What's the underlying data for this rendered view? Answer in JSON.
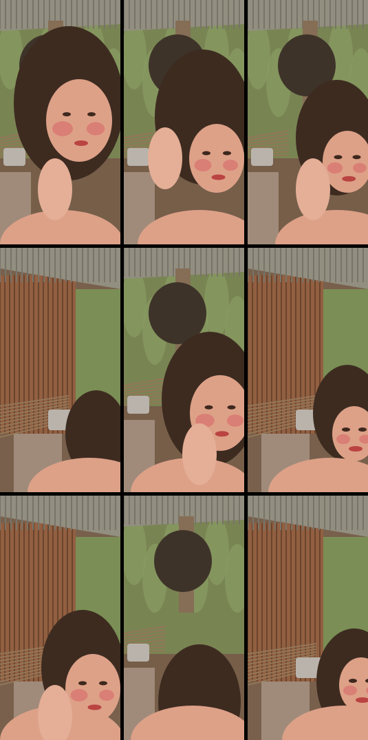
{
  "collage": {
    "layout": "3x3 photo grid",
    "divider_color": "#000000",
    "tiles": [
      {
        "subject": "woman-face-closeup",
        "scene": "outdoor-kitchen"
      },
      {
        "subject": "woman-hand-in-hair",
        "scene": "outdoor-kitchen"
      },
      {
        "subject": "woman-hand-near-face",
        "scene": "outdoor-kitchen"
      },
      {
        "subject": "woman-from-behind",
        "scene": "corrugated-shed"
      },
      {
        "subject": "woman-hand-on-cheek",
        "scene": "outdoor-kitchen"
      },
      {
        "subject": "woman-looking-down",
        "scene": "corrugated-shed"
      },
      {
        "subject": "woman-hand-on-chin",
        "scene": "corrugated-shed"
      },
      {
        "subject": "woman-hair-only",
        "scene": "outdoor-kitchen"
      },
      {
        "subject": "woman-partial-face",
        "scene": "corrugated-shed"
      }
    ],
    "palette": {
      "foliage": "#6f8f55",
      "rust_metal": "#8a5a3e",
      "corrugated_roof": "#8a8f86",
      "skin": "#e0a48f",
      "blush": "#d9656a",
      "hair": "#2a1e18",
      "pot": "#b7b9b8",
      "disc": "#2b2723",
      "sticks": "#8b7358",
      "stove": "#9a8b7f"
    }
  }
}
